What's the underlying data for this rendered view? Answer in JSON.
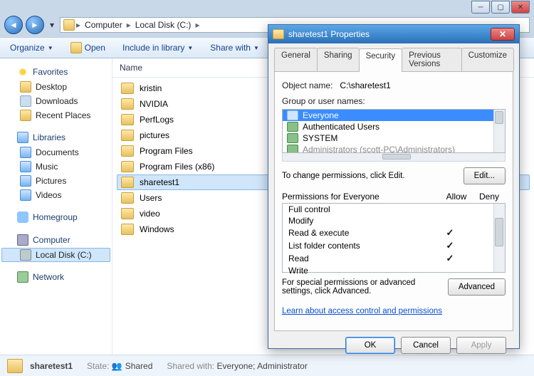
{
  "breadcrumb": {
    "a": "Computer",
    "b": "Local Disk (C:)"
  },
  "toolbar": {
    "organize": "Organize",
    "open": "Open",
    "include": "Include in library",
    "share": "Share with"
  },
  "sidebar": {
    "favorites": "Favorites",
    "desktop": "Desktop",
    "downloads": "Downloads",
    "recent": "Recent Places",
    "libraries": "Libraries",
    "documents": "Documents",
    "music": "Music",
    "pictures": "Pictures",
    "videos": "Videos",
    "homegroup": "Homegroup",
    "computer": "Computer",
    "localdisk": "Local Disk (C:)",
    "network": "Network"
  },
  "columns": {
    "name": "Name"
  },
  "files": [
    "kristin",
    "NVIDIA",
    "PerfLogs",
    "pictures",
    "Program Files",
    "Program Files (x86)",
    "sharetest1",
    "Users",
    "video",
    "Windows"
  ],
  "files_selected_index": 6,
  "status": {
    "name": "sharetest1",
    "state_label": "State:",
    "state_value": "Shared",
    "shared_label": "Shared with:",
    "shared_value": "Everyone; Administrator"
  },
  "dialog": {
    "title": "sharetest1 Properties",
    "tabs": [
      "General",
      "Sharing",
      "Security",
      "Previous Versions",
      "Customize"
    ],
    "active_tab": 2,
    "object_label": "Object name:",
    "object_value": "C:\\sharetest1",
    "groups_label": "Group or user names:",
    "groups": [
      "Everyone",
      "Authenticated Users",
      "SYSTEM",
      "Administrators (scott-PC\\Administrators)"
    ],
    "groups_selected_index": 0,
    "change_text": "To change permissions, click Edit.",
    "edit_btn": "Edit...",
    "perm_label": "Permissions for Everyone",
    "allow": "Allow",
    "deny": "Deny",
    "perms": [
      {
        "name": "Full control",
        "allow": false,
        "deny": false
      },
      {
        "name": "Modify",
        "allow": false,
        "deny": false
      },
      {
        "name": "Read & execute",
        "allow": true,
        "deny": false
      },
      {
        "name": "List folder contents",
        "allow": true,
        "deny": false
      },
      {
        "name": "Read",
        "allow": true,
        "deny": false
      },
      {
        "name": "Write",
        "allow": false,
        "deny": false
      }
    ],
    "adv_text": "For special permissions or advanced settings, click Advanced.",
    "adv_btn": "Advanced",
    "learn_link": "Learn about access control and permissions",
    "ok": "OK",
    "cancel": "Cancel",
    "apply": "Apply"
  }
}
